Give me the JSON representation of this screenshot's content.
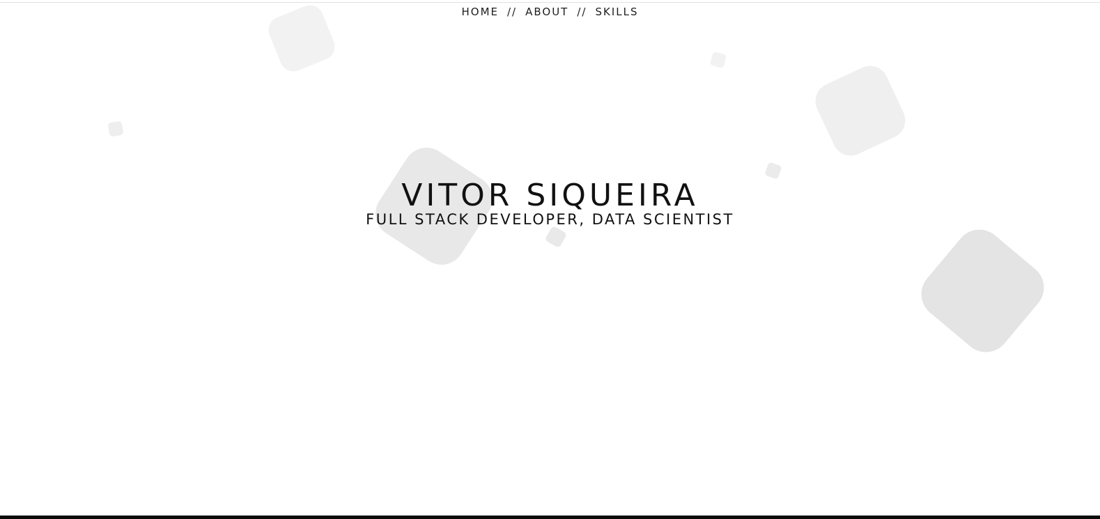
{
  "nav": {
    "items": [
      {
        "label": "HOME"
      },
      {
        "label": "ABOUT"
      },
      {
        "label": "SKILLS"
      }
    ],
    "separator": "//"
  },
  "hero": {
    "title": "VITOR SIQUEIRA",
    "subtitle": "FULL STACK DEVELOPER, DATA SCIENTIST"
  },
  "colors": {
    "background": "#ffffff",
    "text": "#111111",
    "shape_light": "#f3f3f3",
    "shape_mid": "#e8e8e8",
    "bottom_bar": "#0b0b0b"
  }
}
